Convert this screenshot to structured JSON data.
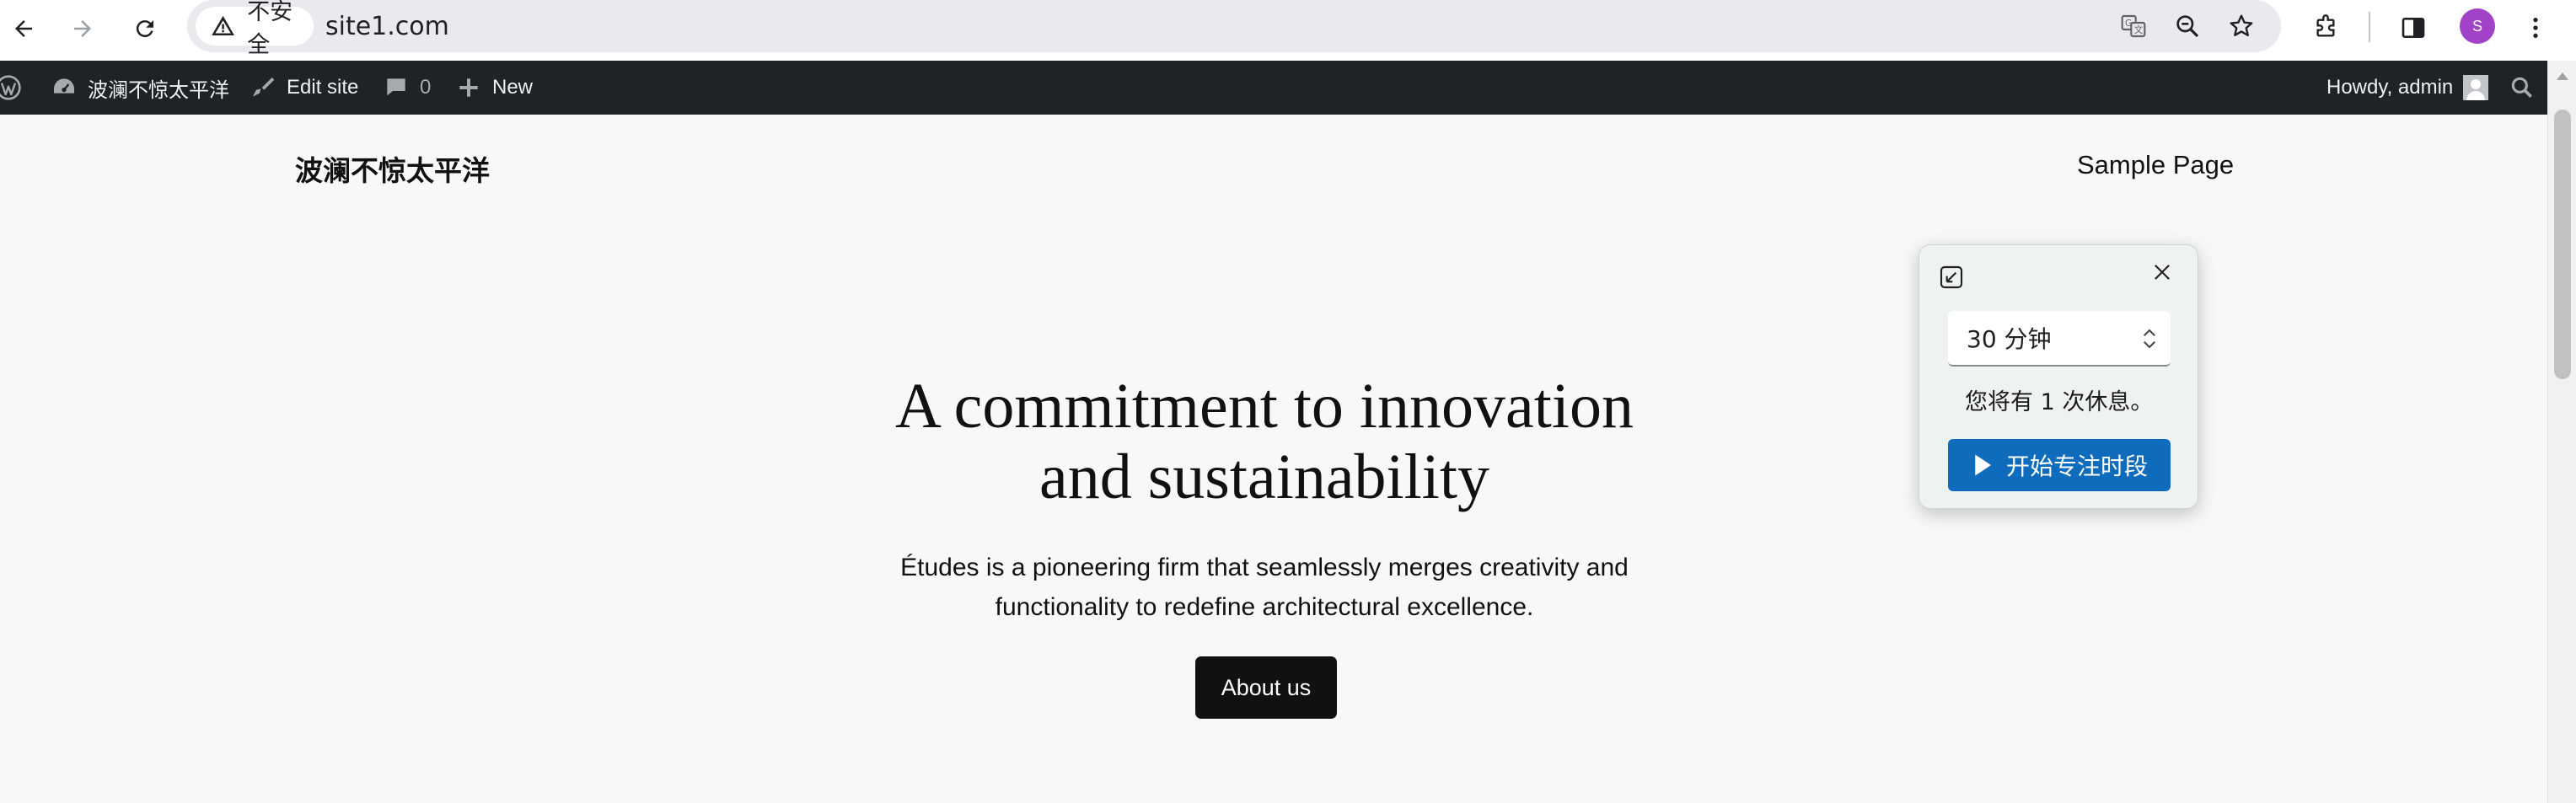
{
  "browser": {
    "security_label": "不安全",
    "url": "site1.com",
    "profile_initial": "S",
    "colors": {
      "profile": "#a142c9",
      "omnibox": "#e8eaed"
    }
  },
  "adminbar": {
    "site_name": "波澜不惊太平洋",
    "edit_site": "Edit site",
    "comments_count": "0",
    "new_label": "New",
    "howdy": "Howdy, admin",
    "colors": {
      "background": "#1d2327",
      "text": "#f0f0f1"
    }
  },
  "site": {
    "title": "波澜不惊太平洋",
    "nav_link": "Sample Page"
  },
  "hero": {
    "heading_line1": "A commitment to innovation",
    "heading_line2": "and sustainability",
    "text_line1": "Études is a pioneering firm that seamlessly merges creativity and",
    "text_line2": "functionality to redefine architectural excellence.",
    "button_label": "About us"
  },
  "focus_popup": {
    "duration_value": "30 分钟",
    "breaks_text": "您将有 1 次休息。",
    "start_button_label": "开始专注时段",
    "colors": {
      "accent": "#0f6cbd",
      "panel": "#eef3ef"
    }
  }
}
